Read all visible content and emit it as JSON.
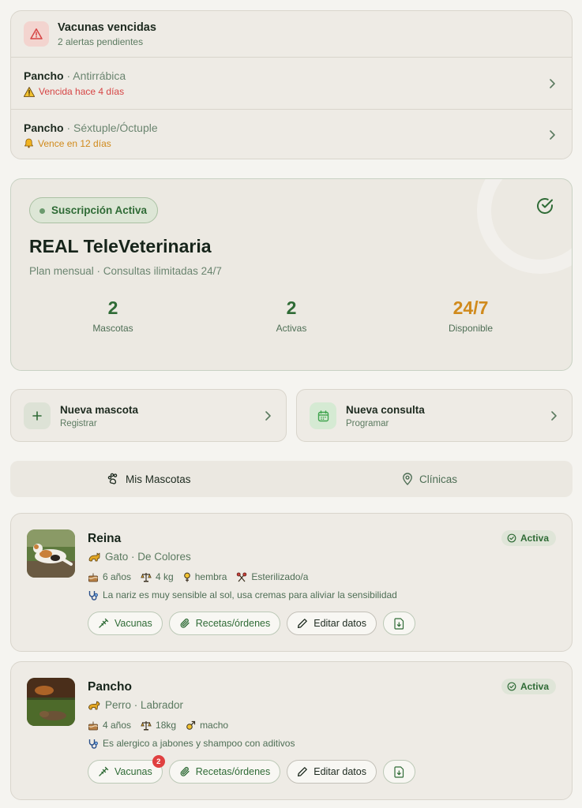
{
  "alerts": {
    "title": "Vacunas vencidas",
    "subtitle": "2 alertas pendientes",
    "items": [
      {
        "pet": "Pancho",
        "sep": " · ",
        "vaccine": "Antirrábica",
        "status": "Vencida hace 4 días",
        "status_color": "#d64545",
        "icon": "warning-icon"
      },
      {
        "pet": "Pancho",
        "sep": " · ",
        "vaccine": "Séxtuple/Óctuple",
        "status": "Vence en 12 días",
        "status_color": "#d08a1c",
        "icon": "bell-icon"
      }
    ]
  },
  "subscription": {
    "badge": "Suscripción Activa",
    "title": "REAL TeleVeterinaria",
    "description": "Plan mensual · Consultas ilimitadas 24/7",
    "stats": [
      {
        "value": "2",
        "label": "Mascotas"
      },
      {
        "value": "2",
        "label": "Activas"
      },
      {
        "value": "24/7",
        "label": "Disponible"
      }
    ]
  },
  "actions": [
    {
      "title": "Nueva mascota",
      "subtitle": "Registrar",
      "icon": "plus-icon"
    },
    {
      "title": "Nueva consulta",
      "subtitle": "Programar",
      "icon": "calendar-icon"
    }
  ],
  "tabs": [
    {
      "label": "Mis Mascotas",
      "icon": "paw-icon",
      "active": true
    },
    {
      "label": "Clínicas",
      "icon": "location-pin-icon",
      "active": false
    }
  ],
  "pets": [
    {
      "name": "Reina",
      "species_breed": "Gato · De Colores",
      "age": "6 años",
      "weight": "4 kg",
      "sex": "hembra",
      "sterilized": "Esterilizado/a",
      "note": "La nariz es muy sensible al sol, usa cremas para aliviar la sensibilidad",
      "status": "Activa",
      "vaccine_alerts": ""
    },
    {
      "name": "Pancho",
      "species_breed": "Perro · Labrador",
      "age": "4 años",
      "weight": "18kg",
      "sex": "macho",
      "note": "Es alergico a jabones y shampoo con aditivos",
      "status": "Activa",
      "vaccine_alerts": "2"
    }
  ],
  "pet_buttons": {
    "vaccines": "Vacunas",
    "prescriptions": "Recetas/órdenes",
    "edit": "Editar datos",
    "download_icon": "file-download-icon"
  },
  "colors": {
    "accent_green": "#2f6b36",
    "warning_orange": "#d08a1c",
    "danger_red": "#d64545",
    "background": "#f5f4f0",
    "card": "#eeebe5"
  }
}
